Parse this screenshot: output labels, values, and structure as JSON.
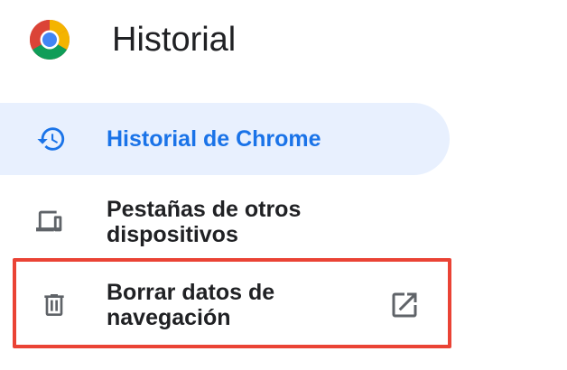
{
  "header": {
    "title": "Historial",
    "logo_icon": "chrome-logo-icon"
  },
  "nav": {
    "items": [
      {
        "label": "Historial de Chrome",
        "icon": "history-icon",
        "selected": true
      },
      {
        "label": "Pestañas de otros dispositivos",
        "icon": "devices-icon",
        "selected": false
      },
      {
        "label": "Borrar datos de navegación",
        "icon": "trash-icon",
        "external_icon": "open-in-new-icon",
        "selected": false,
        "highlighted": true
      }
    ]
  },
  "colors": {
    "selected_background": "#e8f0fe",
    "selected_text": "#1a73e8",
    "highlight_border": "#ea4335",
    "text": "#202124",
    "icon": "#5f6368"
  }
}
